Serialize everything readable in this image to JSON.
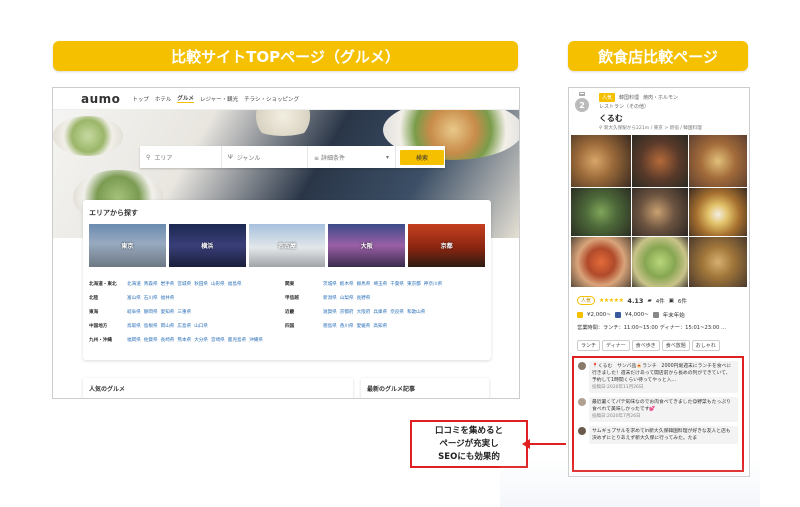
{
  "banners": {
    "left": "比較サイトTOPページ（グルメ）",
    "right": "飲食店比較ページ"
  },
  "aumo": {
    "logo": "aumo",
    "nav": [
      "トップ",
      "ホテル",
      "グルメ",
      "レジャー・観光",
      "チラシ・ショッピング"
    ],
    "nav_active": "グルメ",
    "search": {
      "area_placeholder": "エリア",
      "genre_placeholder": "ジャンル",
      "detail_label": "詳細条件",
      "button": "検索"
    },
    "area_panel": {
      "title": "エリアから探す",
      "tiles": [
        "東京",
        "横浜",
        "名古屋",
        "大阪",
        "京都"
      ],
      "regions_left": [
        {
          "name": "北海道・東北",
          "prefs": [
            "北海道",
            "青森県",
            "岩手県",
            "宮城県",
            "秋田県",
            "山形県",
            "福島県"
          ]
        },
        {
          "name": "北陸",
          "prefs": [
            "富山県",
            "石川県",
            "福井県"
          ]
        },
        {
          "name": "東海",
          "prefs": [
            "岐阜県",
            "静岡県",
            "愛知県",
            "三重県"
          ]
        },
        {
          "name": "中国地方",
          "prefs": [
            "鳥取県",
            "島根県",
            "岡山県",
            "広島県",
            "山口県"
          ]
        },
        {
          "name": "九州・沖縄",
          "prefs": [
            "福岡県",
            "佐賀県",
            "長崎県",
            "熊本県",
            "大分県",
            "宮崎県",
            "鹿児島県",
            "沖縄県"
          ]
        }
      ],
      "regions_right": [
        {
          "name": "関東",
          "prefs": [
            "茨城県",
            "栃木県",
            "群馬県",
            "埼玉県",
            "千葉県",
            "東京都",
            "神奈川県"
          ]
        },
        {
          "name": "甲信越",
          "prefs": [
            "新潟県",
            "山梨県",
            "長野県"
          ]
        },
        {
          "name": "近畿",
          "prefs": [
            "滋賀県",
            "京都府",
            "大阪府",
            "兵庫県",
            "奈良県",
            "和歌山県"
          ]
        },
        {
          "name": "四国",
          "prefs": [
            "徳島県",
            "香川県",
            "愛媛県",
            "高知県"
          ]
        }
      ]
    },
    "bottom": {
      "popular": "人気のグルメ",
      "latest": "最新のグルメ記事"
    }
  },
  "shop": {
    "rank": "2",
    "tag_popular": "人気",
    "tags": [
      "韓国料理",
      "焼肉・ホルモン"
    ],
    "genre2": "レストラン（その他）",
    "name": "くるむ",
    "meta": "新大久保駅から221m / 東京 > 新宿 / 韓国料理",
    "badge": "人気",
    "stars": "★★★★★",
    "rating": "4.13",
    "reviews_count": "4件",
    "photos_count": "6件",
    "price_lunch": "¥2,000~",
    "price_dinner": "¥4,000~",
    "open_all_year": "年末年始",
    "hours": "営業時間：ランチ：11:00~15:00 ディナー：15:01~23:00 ...",
    "chips": [
      "ランチ",
      "ディナー",
      "食べ歩き",
      "食べ放題",
      "おしゃれ"
    ],
    "reviews": [
      {
        "text": "📍くるむ　サンバ品🍝ランチ　2000円堀週末にランチを食べに行きました！週末だけあって開店前から長めの列ができていて、予約して1時間くらい待ってやっと入...",
        "date": "投稿日:2020年11月26日"
      },
      {
        "text": "最近暑くてパテ気味なのでお肉食べてきました😋野菜もたっぷり食べれて美味しかったです💕",
        "date": "投稿日:2020年7月26日"
      },
      {
        "text": "サムギョプサルを求めてin新大久保韓国料理が好きな友人と店も決めずにとりあえず新大久保に行ってみた。たま",
        "date": ""
      }
    ]
  },
  "callout": {
    "lines": [
      "口コミを集めると",
      "ページが充実し",
      "SEOにも効果的"
    ]
  },
  "colors": {
    "accent": "#f5c000",
    "alert": "#e02020",
    "link": "#2a6fb8"
  }
}
